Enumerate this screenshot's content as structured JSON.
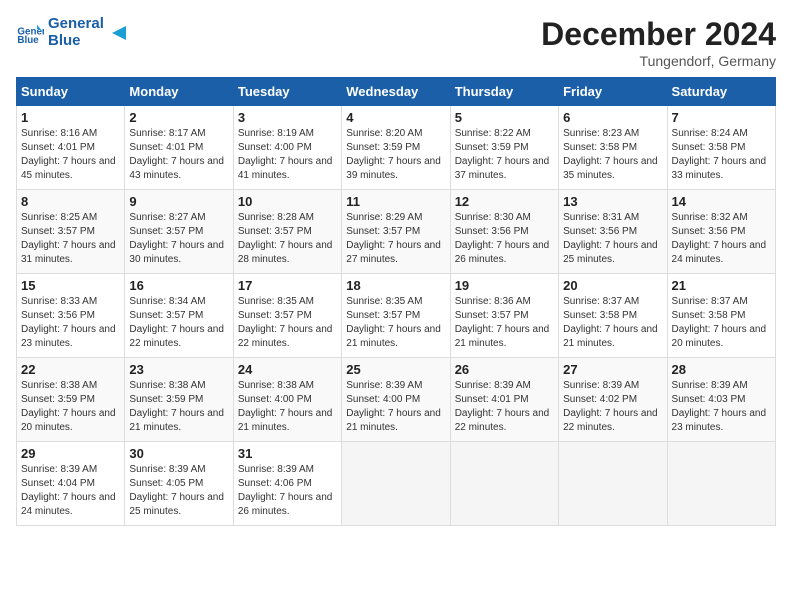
{
  "header": {
    "logo_line1": "General",
    "logo_line2": "Blue",
    "month_year": "December 2024",
    "location": "Tungendorf, Germany"
  },
  "days_of_week": [
    "Sunday",
    "Monday",
    "Tuesday",
    "Wednesday",
    "Thursday",
    "Friday",
    "Saturday"
  ],
  "weeks": [
    [
      {
        "day": 1,
        "sunrise": "8:16 AM",
        "sunset": "4:01 PM",
        "daylight": "7 hours and 45 minutes."
      },
      {
        "day": 2,
        "sunrise": "8:17 AM",
        "sunset": "4:01 PM",
        "daylight": "7 hours and 43 minutes."
      },
      {
        "day": 3,
        "sunrise": "8:19 AM",
        "sunset": "4:00 PM",
        "daylight": "7 hours and 41 minutes."
      },
      {
        "day": 4,
        "sunrise": "8:20 AM",
        "sunset": "3:59 PM",
        "daylight": "7 hours and 39 minutes."
      },
      {
        "day": 5,
        "sunrise": "8:22 AM",
        "sunset": "3:59 PM",
        "daylight": "7 hours and 37 minutes."
      },
      {
        "day": 6,
        "sunrise": "8:23 AM",
        "sunset": "3:58 PM",
        "daylight": "7 hours and 35 minutes."
      },
      {
        "day": 7,
        "sunrise": "8:24 AM",
        "sunset": "3:58 PM",
        "daylight": "7 hours and 33 minutes."
      }
    ],
    [
      {
        "day": 8,
        "sunrise": "8:25 AM",
        "sunset": "3:57 PM",
        "daylight": "7 hours and 31 minutes."
      },
      {
        "day": 9,
        "sunrise": "8:27 AM",
        "sunset": "3:57 PM",
        "daylight": "7 hours and 30 minutes."
      },
      {
        "day": 10,
        "sunrise": "8:28 AM",
        "sunset": "3:57 PM",
        "daylight": "7 hours and 28 minutes."
      },
      {
        "day": 11,
        "sunrise": "8:29 AM",
        "sunset": "3:57 PM",
        "daylight": "7 hours and 27 minutes."
      },
      {
        "day": 12,
        "sunrise": "8:30 AM",
        "sunset": "3:56 PM",
        "daylight": "7 hours and 26 minutes."
      },
      {
        "day": 13,
        "sunrise": "8:31 AM",
        "sunset": "3:56 PM",
        "daylight": "7 hours and 25 minutes."
      },
      {
        "day": 14,
        "sunrise": "8:32 AM",
        "sunset": "3:56 PM",
        "daylight": "7 hours and 24 minutes."
      }
    ],
    [
      {
        "day": 15,
        "sunrise": "8:33 AM",
        "sunset": "3:56 PM",
        "daylight": "7 hours and 23 minutes."
      },
      {
        "day": 16,
        "sunrise": "8:34 AM",
        "sunset": "3:57 PM",
        "daylight": "7 hours and 22 minutes."
      },
      {
        "day": 17,
        "sunrise": "8:35 AM",
        "sunset": "3:57 PM",
        "daylight": "7 hours and 22 minutes."
      },
      {
        "day": 18,
        "sunrise": "8:35 AM",
        "sunset": "3:57 PM",
        "daylight": "7 hours and 21 minutes."
      },
      {
        "day": 19,
        "sunrise": "8:36 AM",
        "sunset": "3:57 PM",
        "daylight": "7 hours and 21 minutes."
      },
      {
        "day": 20,
        "sunrise": "8:37 AM",
        "sunset": "3:58 PM",
        "daylight": "7 hours and 21 minutes."
      },
      {
        "day": 21,
        "sunrise": "8:37 AM",
        "sunset": "3:58 PM",
        "daylight": "7 hours and 20 minutes."
      }
    ],
    [
      {
        "day": 22,
        "sunrise": "8:38 AM",
        "sunset": "3:59 PM",
        "daylight": "7 hours and 20 minutes."
      },
      {
        "day": 23,
        "sunrise": "8:38 AM",
        "sunset": "3:59 PM",
        "daylight": "7 hours and 21 minutes."
      },
      {
        "day": 24,
        "sunrise": "8:38 AM",
        "sunset": "4:00 PM",
        "daylight": "7 hours and 21 minutes."
      },
      {
        "day": 25,
        "sunrise": "8:39 AM",
        "sunset": "4:00 PM",
        "daylight": "7 hours and 21 minutes."
      },
      {
        "day": 26,
        "sunrise": "8:39 AM",
        "sunset": "4:01 PM",
        "daylight": "7 hours and 22 minutes."
      },
      {
        "day": 27,
        "sunrise": "8:39 AM",
        "sunset": "4:02 PM",
        "daylight": "7 hours and 22 minutes."
      },
      {
        "day": 28,
        "sunrise": "8:39 AM",
        "sunset": "4:03 PM",
        "daylight": "7 hours and 23 minutes."
      }
    ],
    [
      {
        "day": 29,
        "sunrise": "8:39 AM",
        "sunset": "4:04 PM",
        "daylight": "7 hours and 24 minutes."
      },
      {
        "day": 30,
        "sunrise": "8:39 AM",
        "sunset": "4:05 PM",
        "daylight": "7 hours and 25 minutes."
      },
      {
        "day": 31,
        "sunrise": "8:39 AM",
        "sunset": "4:06 PM",
        "daylight": "7 hours and 26 minutes."
      },
      null,
      null,
      null,
      null
    ]
  ]
}
